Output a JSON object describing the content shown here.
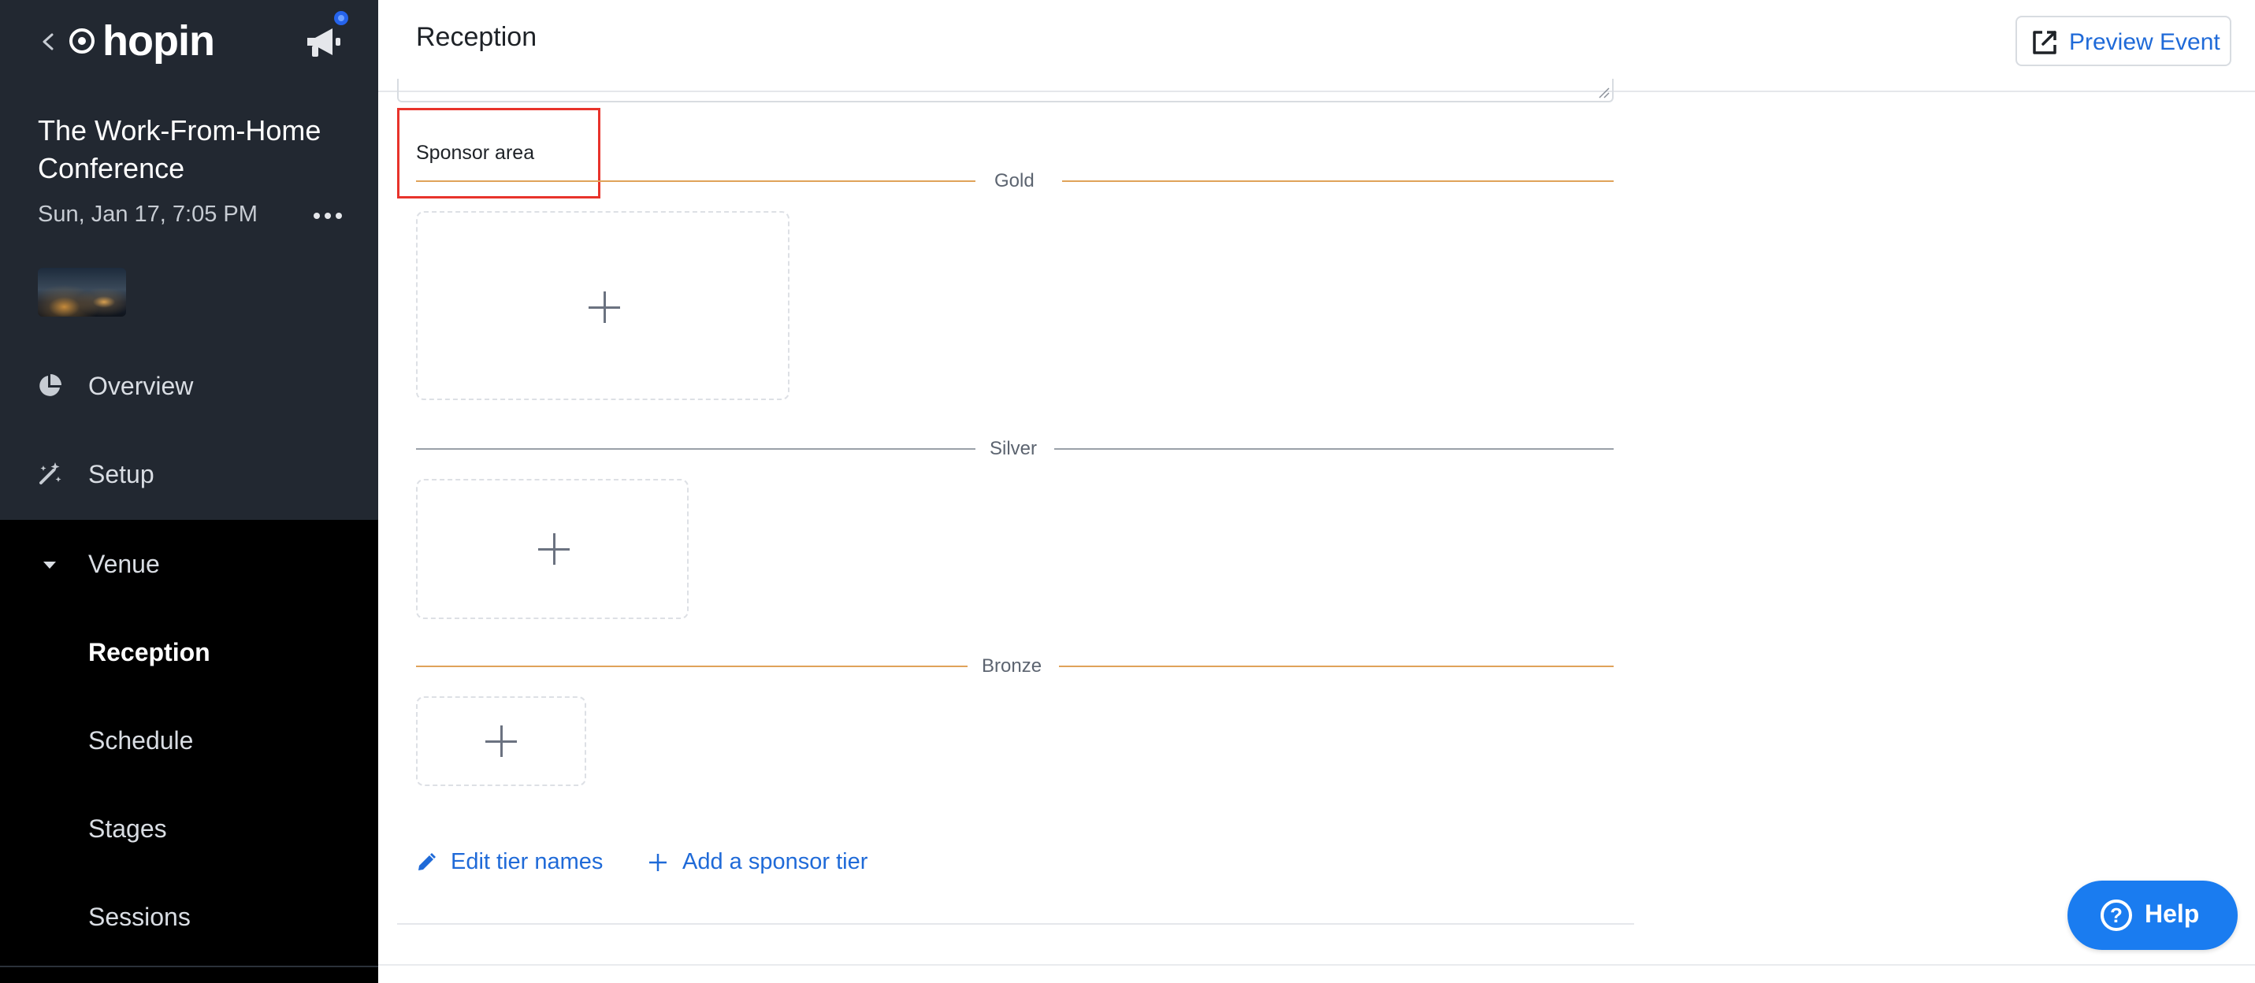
{
  "sidebar": {
    "logo_text": "hopin",
    "event_title": "The Work-From-Home Conference",
    "event_date": "Sun, Jan 17, 7:05 PM",
    "nav": [
      {
        "label": "Overview",
        "icon": "pie-chart-icon"
      },
      {
        "label": "Setup",
        "icon": "magic-wand-icon"
      },
      {
        "label": "Venue",
        "icon": "caret-down-icon"
      }
    ],
    "venue_items": [
      "Reception",
      "Schedule",
      "Stages",
      "Sessions"
    ],
    "active_item": "Reception"
  },
  "header": {
    "title": "Reception",
    "preview_label": "Preview Event"
  },
  "sponsors": {
    "section_label": "Sponsor area",
    "tiers": [
      {
        "name": "Gold",
        "color": "#e0a35a"
      },
      {
        "name": "Silver",
        "color": "#9aa0a8"
      },
      {
        "name": "Bronze",
        "color": "#e0a35a"
      }
    ],
    "edit_tiers_label": "Edit tier names",
    "add_tier_label": "Add a sponsor tier"
  },
  "help": {
    "label": "Help"
  },
  "colors": {
    "sidebar_bg": "#222831",
    "venue_bg": "#000000",
    "link_blue": "#1f6ad8",
    "help_blue": "#1a7cf0",
    "highlight_red": "#e8332b"
  }
}
